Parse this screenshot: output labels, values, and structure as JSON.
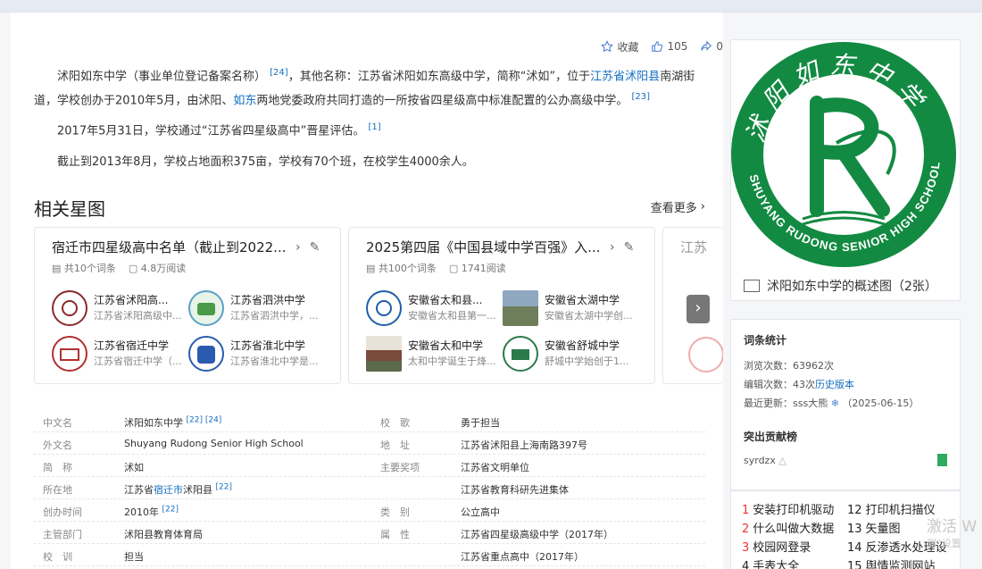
{
  "actions": {
    "collect": "收藏",
    "likes": "105",
    "shares": "0"
  },
  "paragraphs": {
    "p1_a": "沭阳如东中学（事业单位登记备案名称）",
    "p1_sup1": "[24]",
    "p1_b": "，其他名称：江苏省沭阳如东高级中学，简称“沭如”，位于",
    "p1_link1": "江苏省沭阳县",
    "p1_c": "南湖街道，学校创办于2010年5月，由沭阳、",
    "p1_link2": "如东",
    "p1_d": "两地党委政府共同打造的一所按省四星级高中标准配置的公办高级中学。",
    "p1_sup2": "[23]",
    "p2": "2017年5月31日，学校通过“江苏省四星级高中”晋星评估。",
    "p2_sup": "[1]",
    "p3": "截止到2013年8月，学校占地面积375亩，学校有70个班，在校学生4000余人。"
  },
  "section": {
    "title": "相关星图",
    "more": "查看更多"
  },
  "cards": [
    {
      "title": "宿迁市四星级高中名单（截止到2022...",
      "count": "共10个词条",
      "reads": "4.8万阅读",
      "items": [
        {
          "name": "江苏省沭阳高...",
          "desc": "江苏省沭阳高级中..."
        },
        {
          "name": "江苏省泗洪中学",
          "desc": "江苏省泗洪中学，..."
        },
        {
          "name": "江苏省宿迁中学",
          "desc": "江苏省宿迁中学（..."
        },
        {
          "name": "江苏省淮北中学",
          "desc": "江苏省淮北中学是..."
        }
      ]
    },
    {
      "title": "2025第四届《中国县域中学百强》入...",
      "count": "共100个词条",
      "reads": "1741阅读",
      "items": [
        {
          "name": "安徽省太和县...",
          "desc": "安徽省太和县第一..."
        },
        {
          "name": "安徽省太湖中学",
          "desc": "安徽省太湖中学创..."
        },
        {
          "name": "安徽省太和中学",
          "desc": "太和中学诞生于烽..."
        },
        {
          "name": "安徽省舒城中学",
          "desc": "舒城中学始创于1..."
        }
      ]
    },
    {
      "title": "江苏"
    }
  ],
  "info": {
    "rows": [
      {
        "l1": "中文名",
        "v1": "沭阳如东中学",
        "s1": "[22] [24]",
        "l2": "校　歌",
        "v2": "勇于担当"
      },
      {
        "l1": "外文名",
        "v1": "Shuyang Rudong Senior High School",
        "l2": "地　址",
        "v2": "江苏省沭阳县上海南路397号"
      },
      {
        "l1": "简　称",
        "v1": "沭如",
        "l2": "主要奖项",
        "v2": "江苏省文明单位"
      },
      {
        "l1": "所在地",
        "v1a": "江苏省",
        "v1link": "宿迁市",
        "v1b": "沭阳县",
        "s1": "[22]",
        "l2": "",
        "v2": "江苏省教育科研先进集体"
      },
      {
        "l1": "创办时间",
        "v1": "2010年",
        "s1": "[22]",
        "l2": "类　别",
        "v2": "公立高中"
      },
      {
        "l1": "主管部门",
        "v1link": "沭阳县教育体育局",
        "l2": "属　性",
        "v2": "江苏省四星级高级中学（2017年）"
      },
      {
        "l1": "校　训",
        "v1": "担当",
        "l2": "",
        "v2": "江苏省重点高中（2017年）"
      }
    ]
  },
  "sidebar": {
    "logo_text_top": "沭阳如东中学",
    "logo_text_bottom": "SHUYANG RUDONG SENIOR HIGH SCHOOL",
    "pic_label": "沭阳如东中学的概述图（2张）",
    "stats_title": "词条统计",
    "views": "浏览次数：63962次",
    "edits_a": "编辑次数：43次",
    "edits_link": "历史版本",
    "updated_a": "最近更新：",
    "updated_user": "sss大熊",
    "updated_date": "（2025-06-15）",
    "contrib_title": "突出贡献榜",
    "contrib_user": "syrdzx",
    "hot": [
      {
        "n": "1",
        "t": "安装打印机驱动"
      },
      {
        "n": "12",
        "t": "打印机扫描仪"
      },
      {
        "n": "2",
        "t": "什么叫做大数据"
      },
      {
        "n": "13",
        "t": "矢量图"
      },
      {
        "n": "3",
        "t": "校园网登录"
      },
      {
        "n": "14",
        "t": "反渗透水处理设"
      },
      {
        "n": "4",
        "t": "手表大全"
      },
      {
        "n": "15",
        "t": "舆情监测网站"
      }
    ]
  },
  "watermark": {
    "line1": "激活 W",
    "line2": "到“设置"
  }
}
